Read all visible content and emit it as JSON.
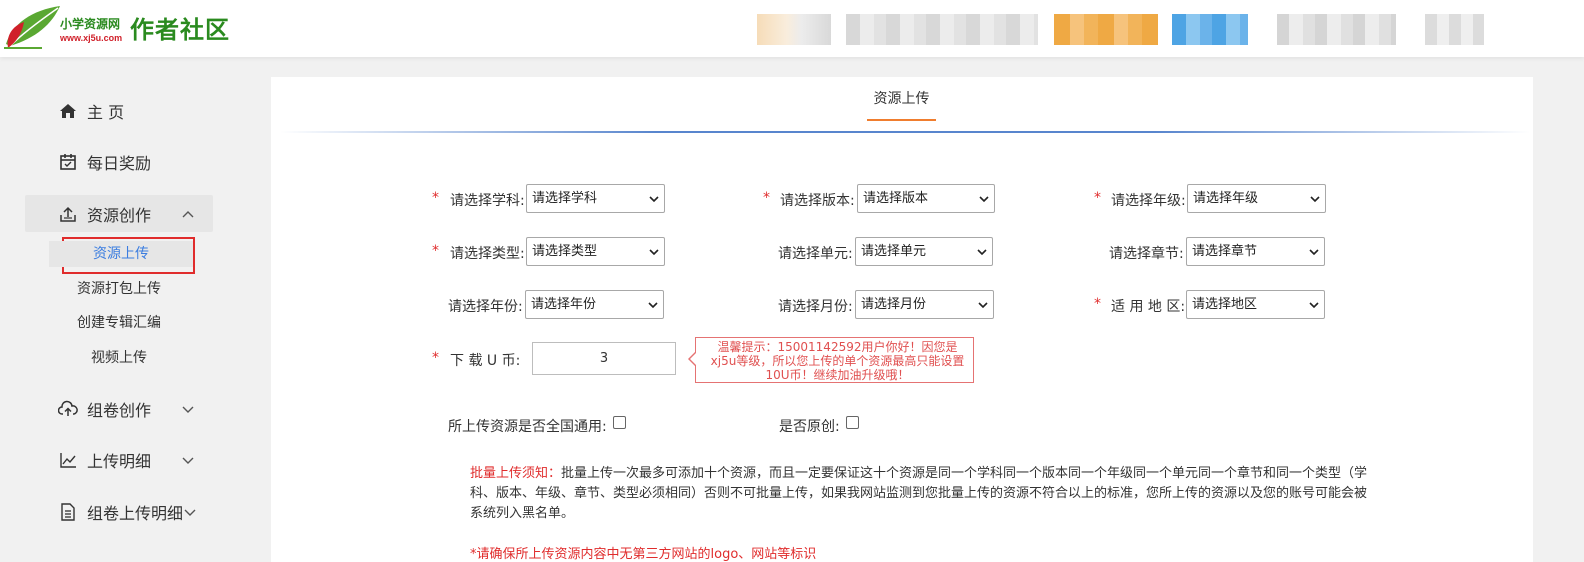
{
  "header": {
    "logo_small": "小学资源网",
    "logo_url": "www.xj5u.com",
    "logo_big": "作者社区"
  },
  "sidebar": {
    "items": [
      {
        "label": "主 页",
        "icon": "home-icon"
      },
      {
        "label": "每日奖励",
        "icon": "calendar-icon"
      },
      {
        "label": "资源创作",
        "icon": "upload-icon"
      },
      {
        "label": "组卷创作",
        "icon": "cloud-upload-icon"
      },
      {
        "label": "上传明细",
        "icon": "chart-line-icon"
      },
      {
        "label": "组卷上传明细",
        "icon": "document-list-icon"
      }
    ],
    "sub_items": [
      "资源上传",
      "资源打包上传",
      "创建专辑汇编",
      "视频上传"
    ]
  },
  "tab": {
    "label": "资源上传"
  },
  "form": {
    "required_mark": "*",
    "subject": {
      "label": "请选择学科:",
      "value": "请选择学科"
    },
    "version": {
      "label": "请选择版本:",
      "value": "请选择版本"
    },
    "grade": {
      "label": "请选择年级:",
      "value": "请选择年级"
    },
    "type": {
      "label": "请选择类型:",
      "value": "请选择类型"
    },
    "unit": {
      "label": "请选择单元:",
      "value": "请选择单元"
    },
    "chapter": {
      "label": "请选择章节:",
      "value": "请选择章节"
    },
    "year": {
      "label": "请选择年份:",
      "value": "请选择年份"
    },
    "month": {
      "label": "请选择月份:",
      "value": "请选择月份"
    },
    "region": {
      "label": "适 用 地 区:",
      "value": "请选择地区"
    },
    "coin": {
      "label": "下 载 U 币:",
      "value": "3"
    },
    "tip": "温馨提示：15001142592用户你好！因您是xj5u等级，所以您上传的单个资源最高只能设置10U币！继续加油升级哦！",
    "national": {
      "label": "所上传资源是否全国通用:"
    },
    "original": {
      "label": "是否原创:"
    }
  },
  "notice": {
    "title": "批量上传须知：",
    "text": "批量上传一次最多可添加十个资源，而且一定要保证这十个资源是同一个学科同一个版本同一个年级同一个单元同一个章节和同一个类型（学科、版本、年级、章节、类型必须相同）否则不可批量上传，如果我网站监测到您批量上传的资源不符合以上的标准，您所上传的资源以及您的账号可能会被系统列入黑名单。",
    "warning": "*请确保所上传资源内容中无第三方网站的logo、网站等标识"
  }
}
